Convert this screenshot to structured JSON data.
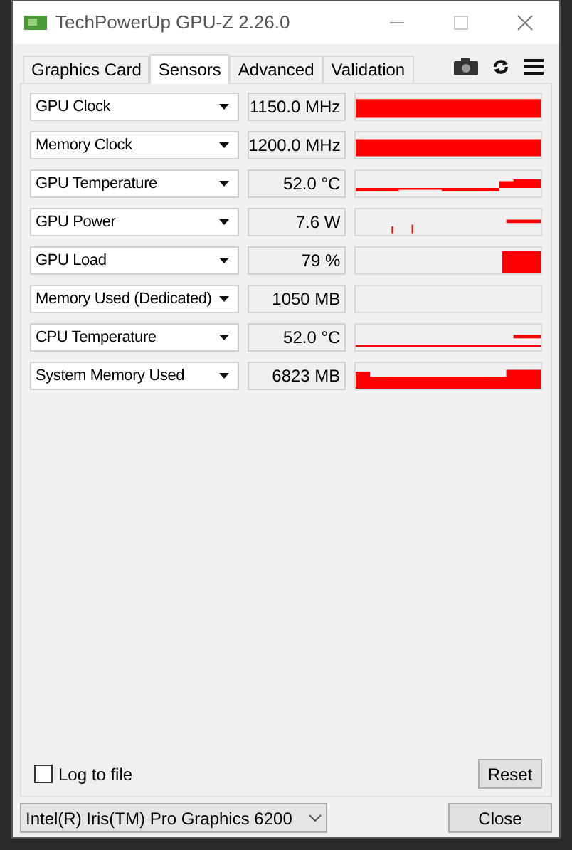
{
  "window": {
    "title": "TechPowerUp GPU-Z 2.26.0"
  },
  "tabs": [
    {
      "label": "Graphics Card",
      "selected": false
    },
    {
      "label": "Sensors",
      "selected": true
    },
    {
      "label": "Advanced",
      "selected": false
    },
    {
      "label": "Validation",
      "selected": false
    }
  ],
  "sensors": [
    {
      "name": "GPU Clock",
      "value": "1150.0 MHz"
    },
    {
      "name": "Memory Clock",
      "value": "1200.0 MHz"
    },
    {
      "name": "GPU Temperature",
      "value": "52.0 °C"
    },
    {
      "name": "GPU Power",
      "value": "7.6 W"
    },
    {
      "name": "GPU Load",
      "value": "79 %"
    },
    {
      "name": "Memory Used (Dedicated)",
      "value": "1050 MB"
    },
    {
      "name": "CPU Temperature",
      "value": "52.0 °C"
    },
    {
      "name": "System Memory Used",
      "value": "6823 MB"
    }
  ],
  "log_to_file": {
    "label": "Log to file",
    "checked": false
  },
  "reset_button": "Reset",
  "device_select": {
    "value": "Intel(R) Iris(TM) Pro Graphics 6200"
  },
  "close_button": "Close"
}
